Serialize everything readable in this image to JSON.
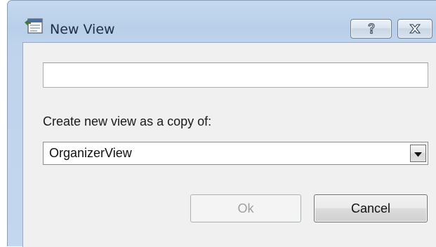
{
  "window": {
    "title": "New View",
    "title_icon": "new-view-app-icon",
    "help_glyph": "?",
    "close_icon": "close-icon"
  },
  "form": {
    "name_input": {
      "value": "",
      "placeholder": ""
    },
    "copy_label": "Create new view as a copy of:",
    "copy_select": {
      "selected": "OrganizerView",
      "arrow_icon": "chevron-down-icon"
    }
  },
  "buttons": {
    "ok_label": "Ok",
    "ok_enabled": false,
    "cancel_label": "Cancel"
  },
  "colors": {
    "titlebar": "#c3d7ee",
    "client": "#f0f0f0",
    "disabled_text": "#a0a0a0"
  }
}
